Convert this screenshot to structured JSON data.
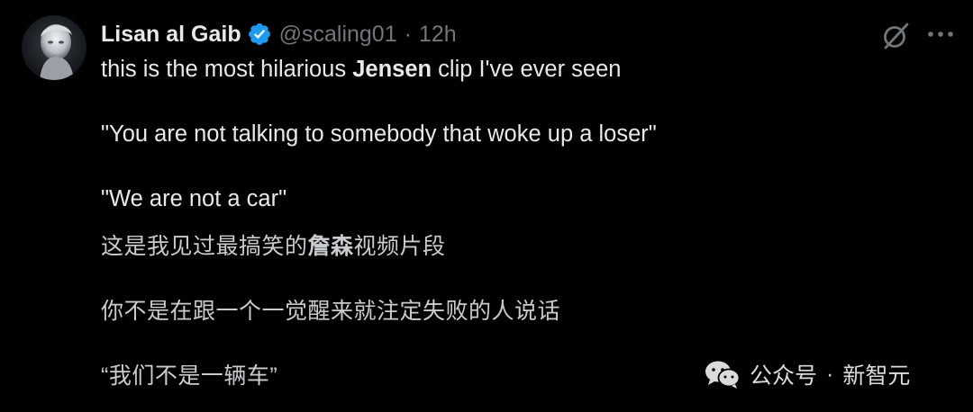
{
  "colors": {
    "background": "#000000",
    "text_primary": "#e7e9ea",
    "text_secondary": "#71767b",
    "verified_blue": "#1d9bf0"
  },
  "tweet": {
    "author": {
      "display_name": "Lisan al Gaib",
      "handle": "@scaling01",
      "verified_icon": "verified-badge-icon",
      "avatar": "avatar"
    },
    "separator": "·",
    "time": "12h",
    "actions": {
      "grok_icon": "grok-slash-icon",
      "more_icon": "more-horizontal-icon"
    },
    "lines": {
      "l1_pre": "this is the most hilarious ",
      "l1_bold": "Jensen",
      "l1_post": " clip I've ever seen",
      "l2": "\"You are not talking to somebody that woke up a loser\"",
      "l3": "\"We are not a car\"",
      "zh1_pre": "这是我见过最搞笑的",
      "zh1_bold": "詹森",
      "zh1_post": "视频片段",
      "zh2": "你不是在跟一个一觉醒来就注定失败的人说话",
      "zh3": "“我们不是一辆车”"
    }
  },
  "watermark": {
    "icon": "wechat-icon",
    "account_type": "公众号",
    "separator": "·",
    "account_name": "新智元"
  }
}
